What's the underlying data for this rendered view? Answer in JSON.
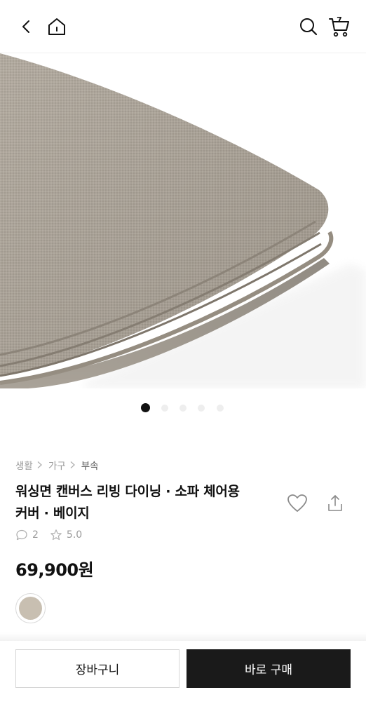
{
  "header": {
    "cart_count": "7"
  },
  "carousel": {
    "total": 5,
    "active_index": 0
  },
  "breadcrumb": [
    "생활",
    "가구",
    "부속"
  ],
  "product": {
    "title_line1": "워싱면 캔버스 리빙 다이닝 · 소파 체어용",
    "title_line2": "커버 · 베이지",
    "review_count": "2",
    "rating": "5.0",
    "price": "69,900원",
    "swatch_color": "#c8bfb1"
  },
  "actions": {
    "cart_label": "장바구니",
    "buy_label": "바로 구매"
  },
  "colors": {
    "accent": "#1a1a1a",
    "fabric": "#a9a196"
  }
}
